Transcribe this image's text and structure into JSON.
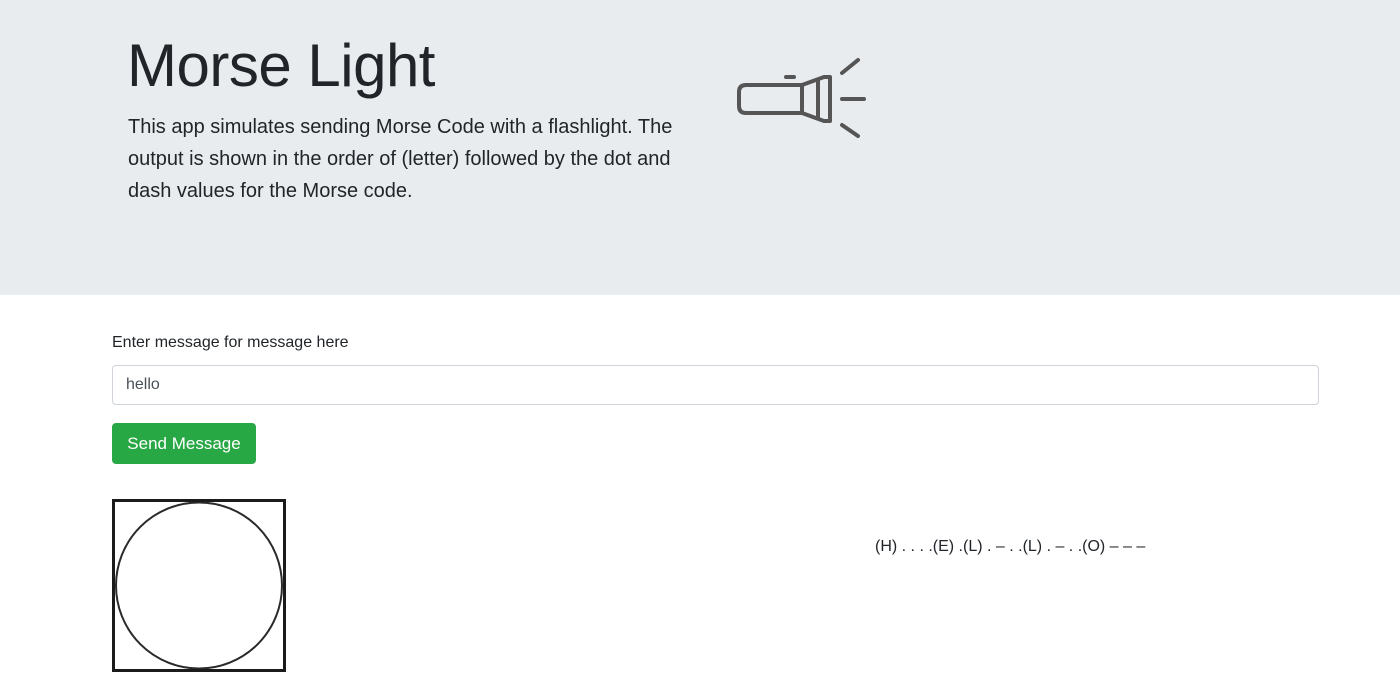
{
  "header": {
    "title": "Morse Light",
    "description": "This app simulates sending Morse Code with a flashlight. The output is shown in the order of (letter) followed by the dot and dash values for the Morse code.",
    "icon": "flashlight-icon"
  },
  "form": {
    "label": "Enter message for message here",
    "input_value": "hello",
    "send_label": "Send Message"
  },
  "light": {
    "icon": "light-bulb-circle",
    "state": "off"
  },
  "output": {
    "morse_text": "(H) . . . .(E) .(L) . – . .(L) . – . .(O) – – –"
  },
  "colors": {
    "jumbotron_bg": "#e9ecef",
    "button_bg": "#28a745",
    "icon_stroke": "#555555"
  }
}
